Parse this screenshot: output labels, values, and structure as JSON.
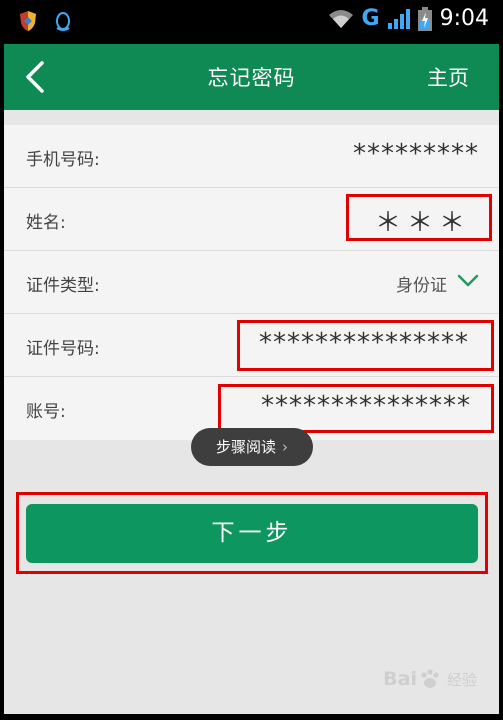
{
  "status_bar": {
    "network": "G",
    "time": "9:04"
  },
  "header": {
    "title": "忘记密码",
    "home": "主页"
  },
  "form": {
    "rows": [
      {
        "label": "手机号码:",
        "value": "*********"
      },
      {
        "label": "姓名:",
        "value": "＊＊＊"
      },
      {
        "label": "证件类型:",
        "value": "身份证"
      },
      {
        "label": "证件号码:",
        "value": "***************"
      },
      {
        "label": "账号:",
        "value": "***************"
      }
    ]
  },
  "toast": {
    "label": "步骤阅读"
  },
  "next_button": {
    "label": "下一步"
  },
  "watermark": {
    "brand": "Bai",
    "suffix": "经验"
  },
  "colors": {
    "header": "#0f8a55",
    "button": "#0e9660",
    "highlight": "#e00000"
  }
}
